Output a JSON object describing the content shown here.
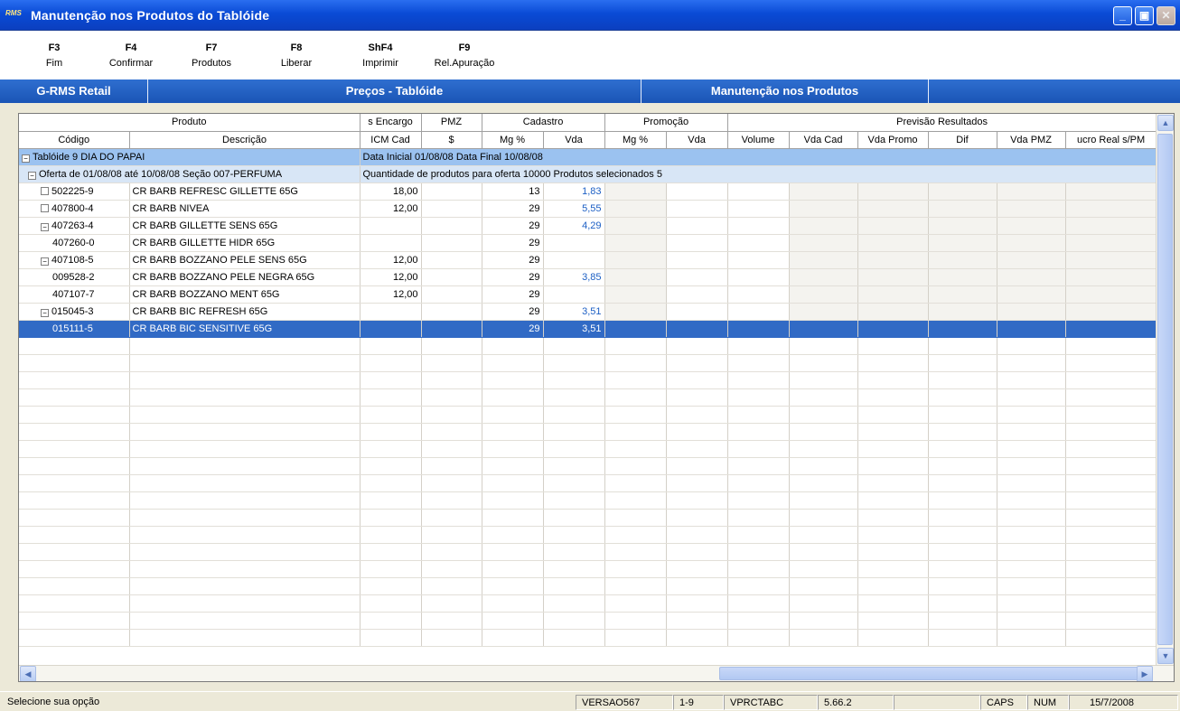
{
  "window": {
    "title": "Manutenção nos Produtos do Tablóide",
    "app_icon": "RMS"
  },
  "fkeys": [
    {
      "key": "F3",
      "label": "Fim"
    },
    {
      "key": "F4",
      "label": "Confirmar"
    },
    {
      "key": "F7",
      "label": "Produtos"
    },
    {
      "key": "F8",
      "label": "Liberar"
    },
    {
      "key": "ShF4",
      "label": "Imprimir"
    },
    {
      "key": "F9",
      "label": "Rel.Apuração"
    }
  ],
  "header_bar": {
    "app": "G-RMS Retail",
    "screen": "Preços - Tablóide",
    "section": "Manutenção nos Produtos"
  },
  "grid": {
    "group_headers": {
      "produto": "Produto",
      "encargo": "s Encargo",
      "pmz": "PMZ",
      "cadastro": "Cadastro",
      "promocao": "Promoção",
      "previsao": "Previsão Resultados"
    },
    "columns": {
      "codigo": "Código",
      "descricao": "Descrição",
      "icm_cad": "ICM Cad",
      "pmz_unit": "$",
      "cad_mg": "Mg %",
      "cad_vda": "Vda",
      "promo_mg": "Mg %",
      "promo_vda": "Vda",
      "volume": "Volume",
      "vda_cad": "Vda Cad",
      "vda_promo": "Vda Promo",
      "dif": "Dif",
      "vda_pmz": "Vda PMZ",
      "lucro": "ucro Real s/PM"
    },
    "tabloide": {
      "label": "Tablóide 9 DIA DO PAPAI",
      "info": "Data Inicial 01/08/08  Data Final 10/08/08"
    },
    "oferta": {
      "label": "Oferta de 01/08/08 até 10/08/08  Seção 007-PERFUMA",
      "info": "Quantidade de produtos para oferta 10000  Produtos selecionados    5"
    },
    "rows": [
      {
        "codigo": "502225-9",
        "descricao": "CR BARB REFRESC GILLETTE 65G",
        "icm": "18,00",
        "mg": "13",
        "vda": "1,83"
      },
      {
        "codigo": "407800-4",
        "descricao": "CR BARB NIVEA",
        "icm": "12,00",
        "mg": "29",
        "vda": "5,55"
      },
      {
        "codigo": "407263-4",
        "descricao": "CR BARB GILLETTE SENS 65G",
        "icm": "",
        "mg": "29",
        "vda": "4,29"
      },
      {
        "codigo": "407260-0",
        "descricao": "CR BARB GILLETTE HIDR 65G",
        "icm": "",
        "mg": "29",
        "vda": ""
      },
      {
        "codigo": "407108-5",
        "descricao": "CR BARB BOZZANO PELE SENS 65G",
        "icm": "12,00",
        "mg": "29",
        "vda": ""
      },
      {
        "codigo": "009528-2",
        "descricao": "CR BARB BOZZANO PELE NEGRA 65G",
        "icm": "12,00",
        "mg": "29",
        "vda": "3,85"
      },
      {
        "codigo": "407107-7",
        "descricao": "CR BARB BOZZANO MENT 65G",
        "icm": "12,00",
        "mg": "29",
        "vda": ""
      },
      {
        "codigo": "015045-3",
        "descricao": "CR BARB BIC REFRESH 65G",
        "icm": "",
        "mg": "29",
        "vda": "3,51"
      },
      {
        "codigo": "015111-5",
        "descricao": "CR BARB BIC SENSITIVE 65G",
        "icm": "",
        "mg": "29",
        "vda": "3,51"
      }
    ]
  },
  "status": {
    "message": "Selecione sua opção",
    "version": "VERSAO567",
    "page": "1-9",
    "program": "VPRCTABC",
    "build": "5.66.2",
    "caps": "CAPS",
    "num": "NUM",
    "date": "15/7/2008"
  }
}
